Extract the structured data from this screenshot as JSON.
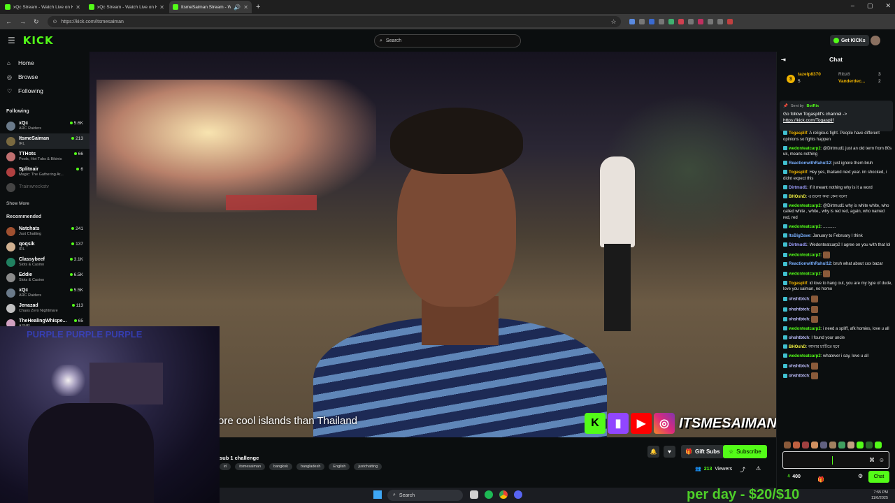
{
  "browser": {
    "tabs": [
      {
        "title": "xQc Stream - Watch Live on Kic"
      },
      {
        "title": "xQc Stream - Watch Live on Kic"
      },
      {
        "title": "ItsmeSaiman Stream - Watc"
      }
    ],
    "url": "https://kick.com/itsmesaiman"
  },
  "header": {
    "logo": "KICK",
    "search_placeholder": "Search",
    "get_kicks": "Get KICKs"
  },
  "sidebar": {
    "nav": [
      {
        "label": "Home",
        "icon": "home-icon"
      },
      {
        "label": "Browse",
        "icon": "compass-icon"
      },
      {
        "label": "Following",
        "icon": "heart-icon"
      }
    ],
    "following_title": "Following",
    "following": [
      {
        "name": "xQc",
        "category": "ARC Raiders",
        "viewers": "5.6K",
        "color": "#6a7a8a"
      },
      {
        "name": "ItsmeSaiman",
        "category": "IRL",
        "viewers": "213",
        "color": "#7a6a40"
      },
      {
        "name": "TTHots",
        "category": "Pools, Hot Tubs & Bikinis",
        "viewers": "66",
        "color": "#c07070"
      },
      {
        "name": "Splitnair",
        "category": "Magic: The Gathering Ar...",
        "viewers": "6",
        "color": "#b04040"
      },
      {
        "name": "Trainwreckstv",
        "category": "",
        "viewers": "",
        "color": "#444"
      }
    ],
    "show_more": "Show More",
    "recommended_title": "Recommended",
    "recommended": [
      {
        "name": "Natchats",
        "category": "Just Chatting",
        "viewers": "241",
        "color": "#a05030"
      },
      {
        "name": "qoqsik",
        "category": "IRL",
        "viewers": "137",
        "color": "#d0b090"
      },
      {
        "name": "Classybeef",
        "category": "Slots & Casino",
        "viewers": "3.1K",
        "color": "#208060"
      },
      {
        "name": "Eddie",
        "category": "Slots & Casino",
        "viewers": "6.5K",
        "color": "#8a8a8a"
      },
      {
        "name": "xQc",
        "category": "ARC Raiders",
        "viewers": "5.5K",
        "color": "#6a7a8a"
      },
      {
        "name": "Jenazad",
        "category": "Chaos Zero Nightmare",
        "viewers": "113",
        "color": "#c0c0c0"
      },
      {
        "name": "TheHealingWhispe...",
        "category": "ASMR",
        "viewers": "65",
        "color": "#d0a0c0"
      }
    ]
  },
  "video": {
    "caption": "ore cool islands than Thailand",
    "brand_name": "ITSMESAIMAN",
    "cam_text": "PURPLE PURPLE PURPLE"
  },
  "stream": {
    "title": "sub 1 challenge",
    "tags": [
      "irl",
      "itsmesaiman",
      "bangkok",
      "bangladesh",
      "English",
      "justchatting"
    ],
    "gift_subs": "Gift Subs",
    "subscribe": "Subscribe",
    "viewers": "213",
    "viewers_label": "Viewers"
  },
  "chat": {
    "title": "Chat",
    "leaderboard": [
      {
        "name": "tazelp8370",
        "value": "5"
      },
      {
        "name": "Ribz8",
        "value": "3"
      },
      {
        "name": "Vanderdec...",
        "value": "2"
      }
    ],
    "pinned": {
      "sent_by": "Sent by",
      "bot": "BotRix",
      "message": "Go follow Togasplif's channel ->",
      "link": "https://kick.com/Togasplif"
    },
    "messages": [
      {
        "user": "Togasplif",
        "color": "#f0b400",
        "text": "A religious fight. People have different opinions so fights happen"
      },
      {
        "user": "wedonteatcarp2",
        "color": "#53fc18",
        "text": "@Dirtmud1 just an old term from 80s uk, means nothing"
      },
      {
        "user": "ReactionwithRahul12",
        "color": "#7ab0ff",
        "text": "just ignore them bruh"
      },
      {
        "user": "Togasplif",
        "color": "#f0b400",
        "text": "Hey yes, thailand next year. im shocked, i didnt expect this"
      },
      {
        "user": "Dirtmud1",
        "color": "#a0a0ff",
        "text": "if it meant nothing why is it a word"
      },
      {
        "user": "BHOshD",
        "color": "#f0f040",
        "text": "এগুলো কথা কেন বলো"
      },
      {
        "user": "wedonteatcarp2",
        "color": "#53fc18",
        "text": "@Dirtmud1 why is white white, who called white , white,, why is red red, again, who named red, red"
      },
      {
        "user": "wedonteatcarp2",
        "color": "#53fc18",
        "text": "..........."
      },
      {
        "user": "ItsBigDave",
        "color": "#7ab0ff",
        "text": "January to February I think"
      },
      {
        "user": "Dirtmud1",
        "color": "#a0a0ff",
        "text": "Wedonteatcarp2 I agree on you with that lol"
      },
      {
        "user": "wedonteatcarp2",
        "color": "#53fc18",
        "text": ""
      },
      {
        "user": "ReactionwithRahul12",
        "color": "#7ab0ff",
        "text": "bruh what about cox bazar"
      },
      {
        "user": "wedonteatcarp2",
        "color": "#53fc18",
        "text": ""
      },
      {
        "user": "Togasplif",
        "color": "#f0b400",
        "text": "id love to hang out, you are my type of dude, love you saiman, no homo"
      },
      {
        "user": "ohshtbtch",
        "color": "#c0c0ff",
        "text": ""
      },
      {
        "user": "ohshtbtch",
        "color": "#c0c0ff",
        "text": ""
      },
      {
        "user": "ohshtbtch",
        "color": "#c0c0ff",
        "text": ""
      },
      {
        "user": "wedonteatcarp2",
        "color": "#53fc18",
        "text": "i need a spliff, afk homies, love u all"
      },
      {
        "user": "ohshtbtch",
        "color": "#c0c0ff",
        "text": "I found your uncle"
      },
      {
        "user": "BHOshD",
        "color": "#f0f040",
        "text": "আবার চাটিতে হবে"
      },
      {
        "user": "wedonteatcarp2",
        "color": "#53fc18",
        "text": "whatever i say, love u all"
      },
      {
        "user": "ohshtbtch",
        "color": "#c0c0ff",
        "text": ""
      },
      {
        "user": "ohshtbtch",
        "color": "#c0c0ff",
        "text": ""
      }
    ],
    "points": "400",
    "send": "Chat"
  },
  "taskbar": {
    "search": "Search",
    "time": "7:55 PM",
    "date": "11/6/2025"
  },
  "promo": "per day - $20/$10",
  "accent": "#53fc18"
}
